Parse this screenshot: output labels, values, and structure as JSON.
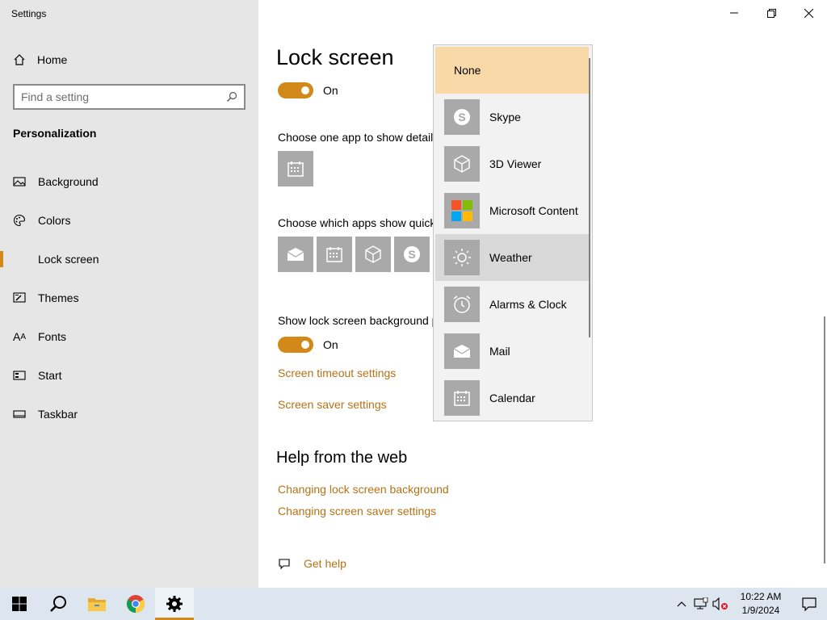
{
  "window": {
    "title": "Settings"
  },
  "sidebar": {
    "home_label": "Home",
    "search_placeholder": "Find a setting",
    "section_title": "Personalization",
    "items": [
      {
        "label": "Background",
        "icon": "image-icon"
      },
      {
        "label": "Colors",
        "icon": "palette-icon"
      },
      {
        "label": "Lock screen",
        "icon": "lock-screen-icon",
        "selected": true
      },
      {
        "label": "Themes",
        "icon": "themes-icon"
      },
      {
        "label": "Fonts",
        "icon": "font-icon"
      },
      {
        "label": "Start",
        "icon": "start-icon"
      },
      {
        "label": "Taskbar",
        "icon": "taskbar-icon"
      }
    ]
  },
  "main": {
    "title": "Lock screen",
    "toggle1_state": "On",
    "detail_app_label": "Choose one app to show detail",
    "quick_apps_label": "Choose which apps show quick",
    "show_bg_label": "Show lock screen background p",
    "toggle2_state": "On",
    "links": {
      "screen_timeout": "Screen timeout settings",
      "screen_saver": "Screen saver settings"
    },
    "help": {
      "title": "Help from the web",
      "link1": "Changing lock screen background",
      "link2": "Changing screen saver settings",
      "get_help": "Get help"
    }
  },
  "dropdown": {
    "items": [
      {
        "label": "None",
        "selected": true
      },
      {
        "label": "Skype",
        "icon": "skype-icon"
      },
      {
        "label": "3D Viewer",
        "icon": "cube-icon"
      },
      {
        "label": "Microsoft Content",
        "icon": "microsoft-logo-icon"
      },
      {
        "label": "Weather",
        "icon": "weather-icon",
        "hover": true
      },
      {
        "label": "Alarms & Clock",
        "icon": "alarm-clock-icon"
      },
      {
        "label": "Mail",
        "icon": "mail-icon"
      },
      {
        "label": "Calendar",
        "icon": "calendar-icon"
      }
    ]
  },
  "taskbar": {
    "time": "10:22 AM",
    "date": "1/9/2024"
  },
  "colors": {
    "accent": "#d3881a",
    "link": "#b57216",
    "sidebar_bg": "#e6e6e6",
    "tile": "#a9a9a9"
  }
}
